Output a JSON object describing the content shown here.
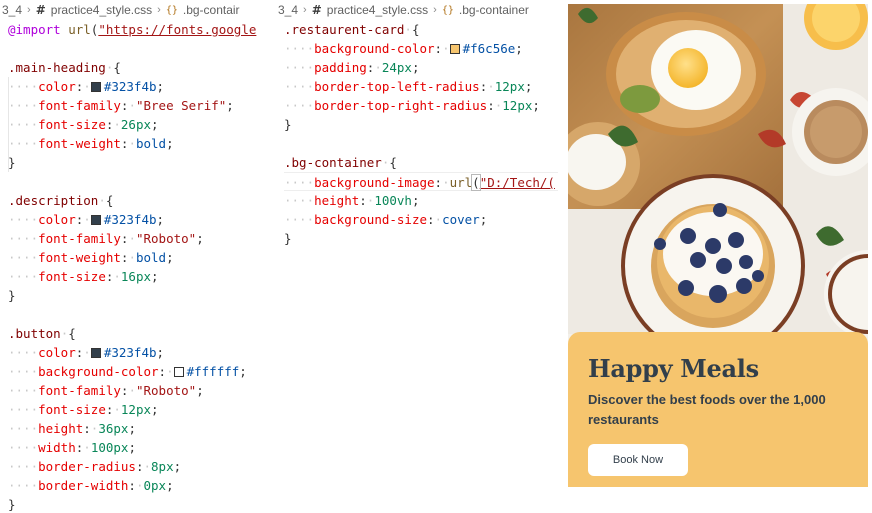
{
  "left_pane": {
    "breadcrumb": {
      "folder": "3_4",
      "file": "practice4_style.css",
      "symbol": ".bg-contair"
    },
    "import_line": {
      "keyword": "@import",
      "fn": "url",
      "value": "\"https://fonts.google"
    },
    "rules": [
      {
        "selector": ".main-heading",
        "decls": [
          {
            "prop": "color",
            "swatch": "#323f4b",
            "value": "#323f4b"
          },
          {
            "prop": "font-family",
            "value": "\"Bree Serif\""
          },
          {
            "prop": "font-size",
            "value": "26px"
          },
          {
            "prop": "font-weight",
            "value": "bold"
          }
        ]
      },
      {
        "selector": ".description",
        "decls": [
          {
            "prop": "color",
            "swatch": "#323f4b",
            "value": "#323f4b"
          },
          {
            "prop": "font-family",
            "value": "\"Roboto\""
          },
          {
            "prop": "font-weight",
            "value": "bold"
          },
          {
            "prop": "font-size",
            "value": "16px"
          }
        ]
      },
      {
        "selector": ".button",
        "decls": [
          {
            "prop": "color",
            "swatch": "#323f4b",
            "value": "#323f4b"
          },
          {
            "prop": "background-color",
            "swatch": "#ffffff",
            "value": "#ffffff"
          },
          {
            "prop": "font-family",
            "value": "\"Roboto\""
          },
          {
            "prop": "font-size",
            "value": "12px"
          },
          {
            "prop": "height",
            "value": "36px"
          },
          {
            "prop": "width",
            "value": "100px"
          },
          {
            "prop": "border-radius",
            "value": "8px"
          },
          {
            "prop": "border-width",
            "value": "0px"
          }
        ]
      }
    ]
  },
  "mid_pane": {
    "breadcrumb": {
      "folder": "3_4",
      "file": "practice4_style.css",
      "symbol": ".bg-container"
    },
    "rules": [
      {
        "selector": ".restaurent-card",
        "decls": [
          {
            "prop": "background-color",
            "swatch": "#f6c56e",
            "value": "#f6c56e"
          },
          {
            "prop": "padding",
            "value": "24px"
          },
          {
            "prop": "border-top-left-radius",
            "value": "12px"
          },
          {
            "prop": "border-top-right-radius",
            "value": "12px"
          }
        ]
      },
      {
        "selector": ".bg-container",
        "decls": [
          {
            "prop": "background-image",
            "fn": "url",
            "value": "\"D:/Tech/("
          },
          {
            "prop": "height",
            "value": "100vh"
          },
          {
            "prop": "background-size",
            "value": "cover"
          }
        ]
      }
    ]
  },
  "preview": {
    "title": "Happy Meals",
    "description": "Discover the best foods over the 1,000 restaurants",
    "button_label": "Book Now",
    "card_color": "#f6c56e",
    "text_color": "#323f4b"
  },
  "icons": {
    "file_icon": "hash-icon",
    "symbol_icon": "css-rule-icon",
    "separator": "chevron-right-icon"
  }
}
